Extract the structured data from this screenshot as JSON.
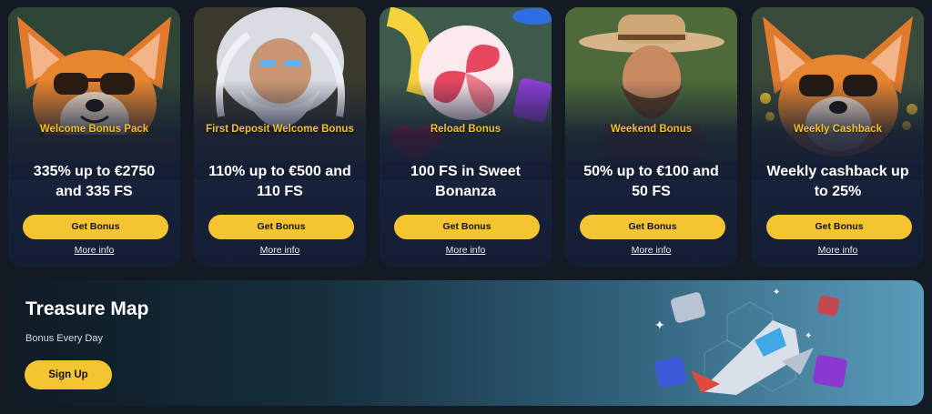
{
  "promos": [
    {
      "tag": "Welcome Bonus Pack",
      "headline_1": "335% up to €2750",
      "headline_2": "and 335 FS",
      "button": "Get Bonus",
      "more": "More info",
      "art": "corgi-sunglasses-illustration"
    },
    {
      "tag": "First Deposit Welcome Bonus",
      "headline_1": "110% up to €500 and",
      "headline_2": "110 FS",
      "button": "Get Bonus",
      "more": "More info",
      "art": "zeus-illustration"
    },
    {
      "tag": "Reload Bonus",
      "headline_1": "100 FS in Sweet",
      "headline_2": "Bonanza",
      "button": "Get Bonus",
      "more": "More info",
      "art": "lollipop-candy-illustration"
    },
    {
      "tag": "Weekend Bonus",
      "headline_1": "50% up to €100 and",
      "headline_2": "50 FS",
      "button": "Get Bonus",
      "more": "More info",
      "art": "cowboy-illustration"
    },
    {
      "tag": "Weekly Cashback",
      "headline_1": "Weekly cashback up",
      "headline_2": "to 25%",
      "button": "Get Bonus",
      "more": "More info",
      "art": "corgi-coins-illustration"
    }
  ],
  "treasure": {
    "title": "Treasure Map",
    "subtitle": "Bonus Every Day",
    "button": "Sign Up",
    "art": "spaceship-treasure-chests-illustration"
  },
  "colors": {
    "accent": "#f5c531",
    "tag": "#f4c21f",
    "background": "#131a24"
  }
}
